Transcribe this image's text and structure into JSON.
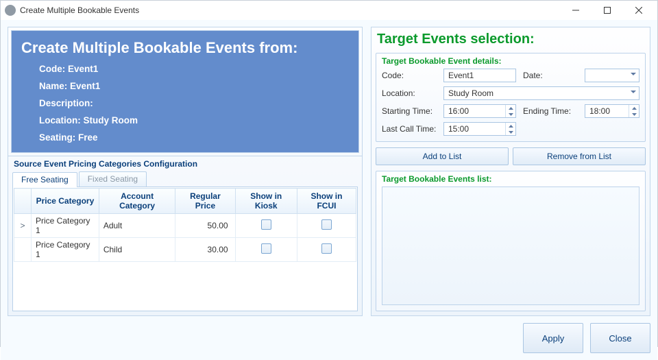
{
  "window": {
    "title": "Create Multiple Bookable Events"
  },
  "source_header": {
    "heading": "Create Multiple Bookable Events from:",
    "code_label": "Code",
    "code_value": "Event1",
    "name_label": "Name",
    "name_value": "Event1",
    "description_label": "Description",
    "description_value": "",
    "location_label": "Location",
    "location_value": "Study Room",
    "seating_label": "Seating",
    "seating_value": "Free"
  },
  "pricing_section_title": "Source Event Pricing Categories Configuration",
  "tabs": {
    "free": "Free Seating",
    "fixed": "Fixed Seating"
  },
  "grid": {
    "cols": {
      "price_cat": "Price Category",
      "account_cat": "Account Category",
      "regular_price": "Regular Price",
      "show_kiosk": "Show in Kiosk",
      "show_fcui": "Show in FCUI"
    },
    "rows": [
      {
        "marker": ">",
        "price_cat": "Price Category 1",
        "account_cat": "Adult",
        "regular_price": "50.00",
        "show_kiosk": false,
        "show_fcui": false
      },
      {
        "marker": "",
        "price_cat": "Price Category 1",
        "account_cat": "Child",
        "regular_price": "30.00",
        "show_kiosk": false,
        "show_fcui": false
      }
    ]
  },
  "target": {
    "heading": "Target Events selection:",
    "details_title": "Target Bookable Event details:",
    "labels": {
      "code": "Code:",
      "date": "Date:",
      "location": "Location:",
      "starting": "Starting Time:",
      "ending": "Ending Time:",
      "lastcall": "Last Call Time:"
    },
    "values": {
      "code": "Event1",
      "date": "",
      "location": "Study Room",
      "starting": "16:00",
      "ending": "18:00",
      "lastcall": "15:00"
    },
    "add_btn": "Add to List",
    "remove_btn": "Remove from List",
    "list_title": "Target Bookable Events list:"
  },
  "footer": {
    "apply": "Apply",
    "close": "Close"
  }
}
